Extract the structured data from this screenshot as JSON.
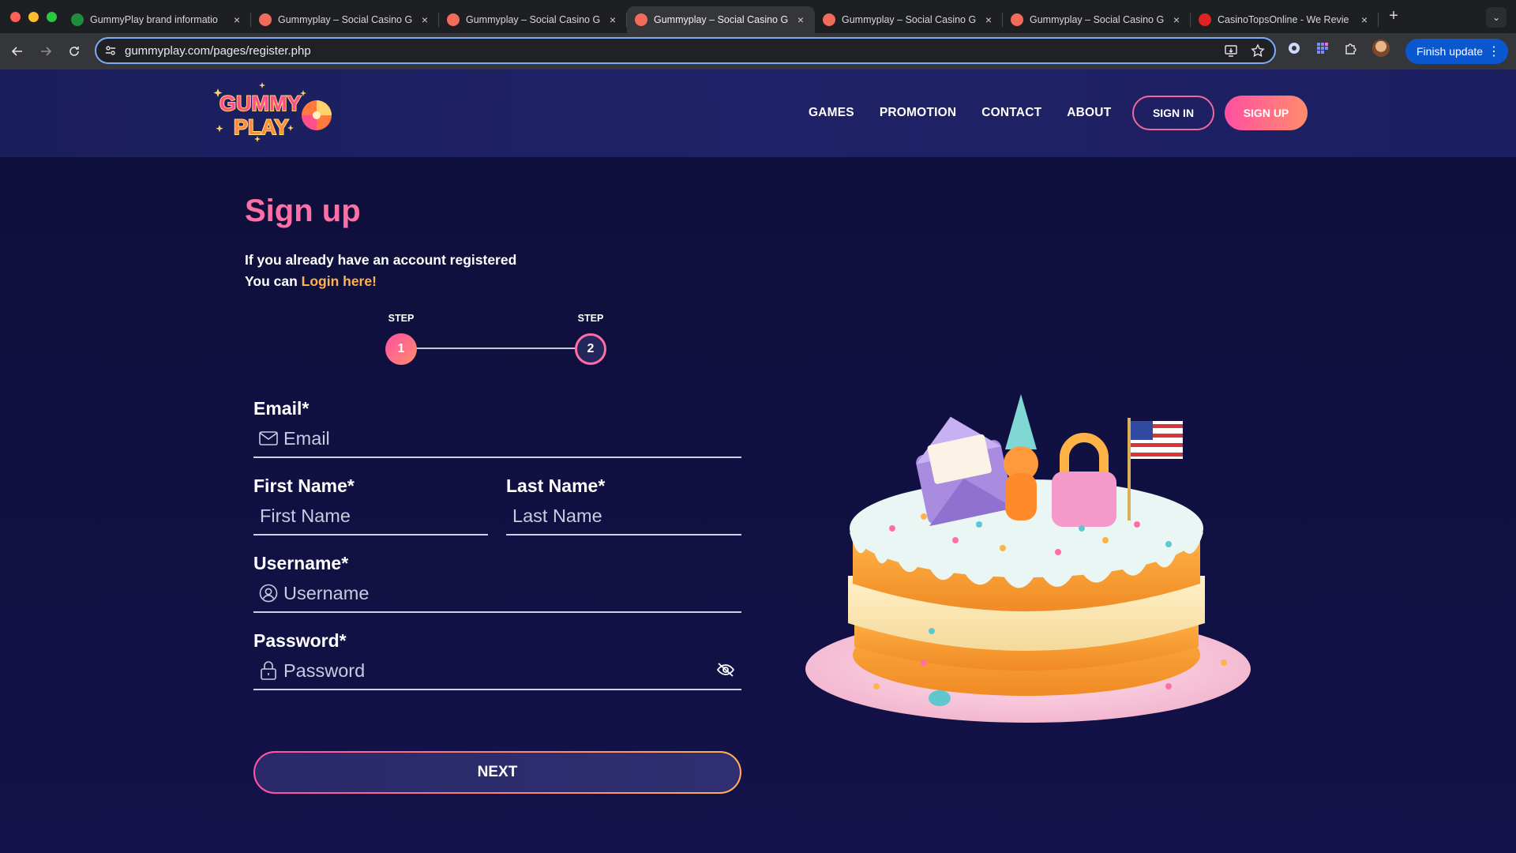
{
  "browser": {
    "tabs": [
      {
        "label": "GummyPlay brand informatio",
        "favicon_color": "#1e8e3e",
        "active": false
      },
      {
        "label": "Gummyplay – Social Casino G",
        "favicon_color": "#f26b5b",
        "active": false
      },
      {
        "label": "Gummyplay – Social Casino G",
        "favicon_color": "#f26b5b",
        "active": false
      },
      {
        "label": "Gummyplay – Social Casino G",
        "favicon_color": "#f26b5b",
        "active": true
      },
      {
        "label": "Gummyplay – Social Casino G",
        "favicon_color": "#f26b5b",
        "active": false
      },
      {
        "label": "Gummyplay – Social Casino G",
        "favicon_color": "#f26b5b",
        "active": false
      },
      {
        "label": "CasinoTopsOnline - We Revie",
        "favicon_color": "#e02424",
        "active": false
      }
    ],
    "url": "gummyplay.com/pages/register.php",
    "finish_update": "Finish update"
  },
  "header": {
    "logo_text_top": "GUMMY",
    "logo_text_bottom": "PLAY",
    "nav": [
      "GAMES",
      "PROMOTION",
      "CONTACT",
      "ABOUT"
    ],
    "sign_in": "SIGN IN",
    "sign_up": "SIGN UP"
  },
  "form": {
    "title": "Sign up",
    "intro_line1": "If you already have an account registered",
    "intro_line2_prefix": "You can ",
    "login_link": "Login here!",
    "steps": [
      {
        "label": "STEP",
        "number": "1"
      },
      {
        "label": "STEP",
        "number": "2"
      }
    ],
    "email_label": "Email*",
    "email_placeholder": "Email",
    "first_name_label": "First Name*",
    "first_name_placeholder": "First Name",
    "last_name_label": "Last Name*",
    "last_name_placeholder": "Last Name",
    "username_label": "Username*",
    "username_placeholder": "Username",
    "password_label": "Password*",
    "password_placeholder": "Password",
    "next_button": "NEXT"
  },
  "colors": {
    "accent_pink": "#ff6fa5",
    "accent_orange": "#ffb24d",
    "background": "#10103c"
  },
  "icons": [
    "mail-icon",
    "user-circle-icon",
    "lock-icon",
    "eye-off-icon",
    "cake-illustration"
  ]
}
